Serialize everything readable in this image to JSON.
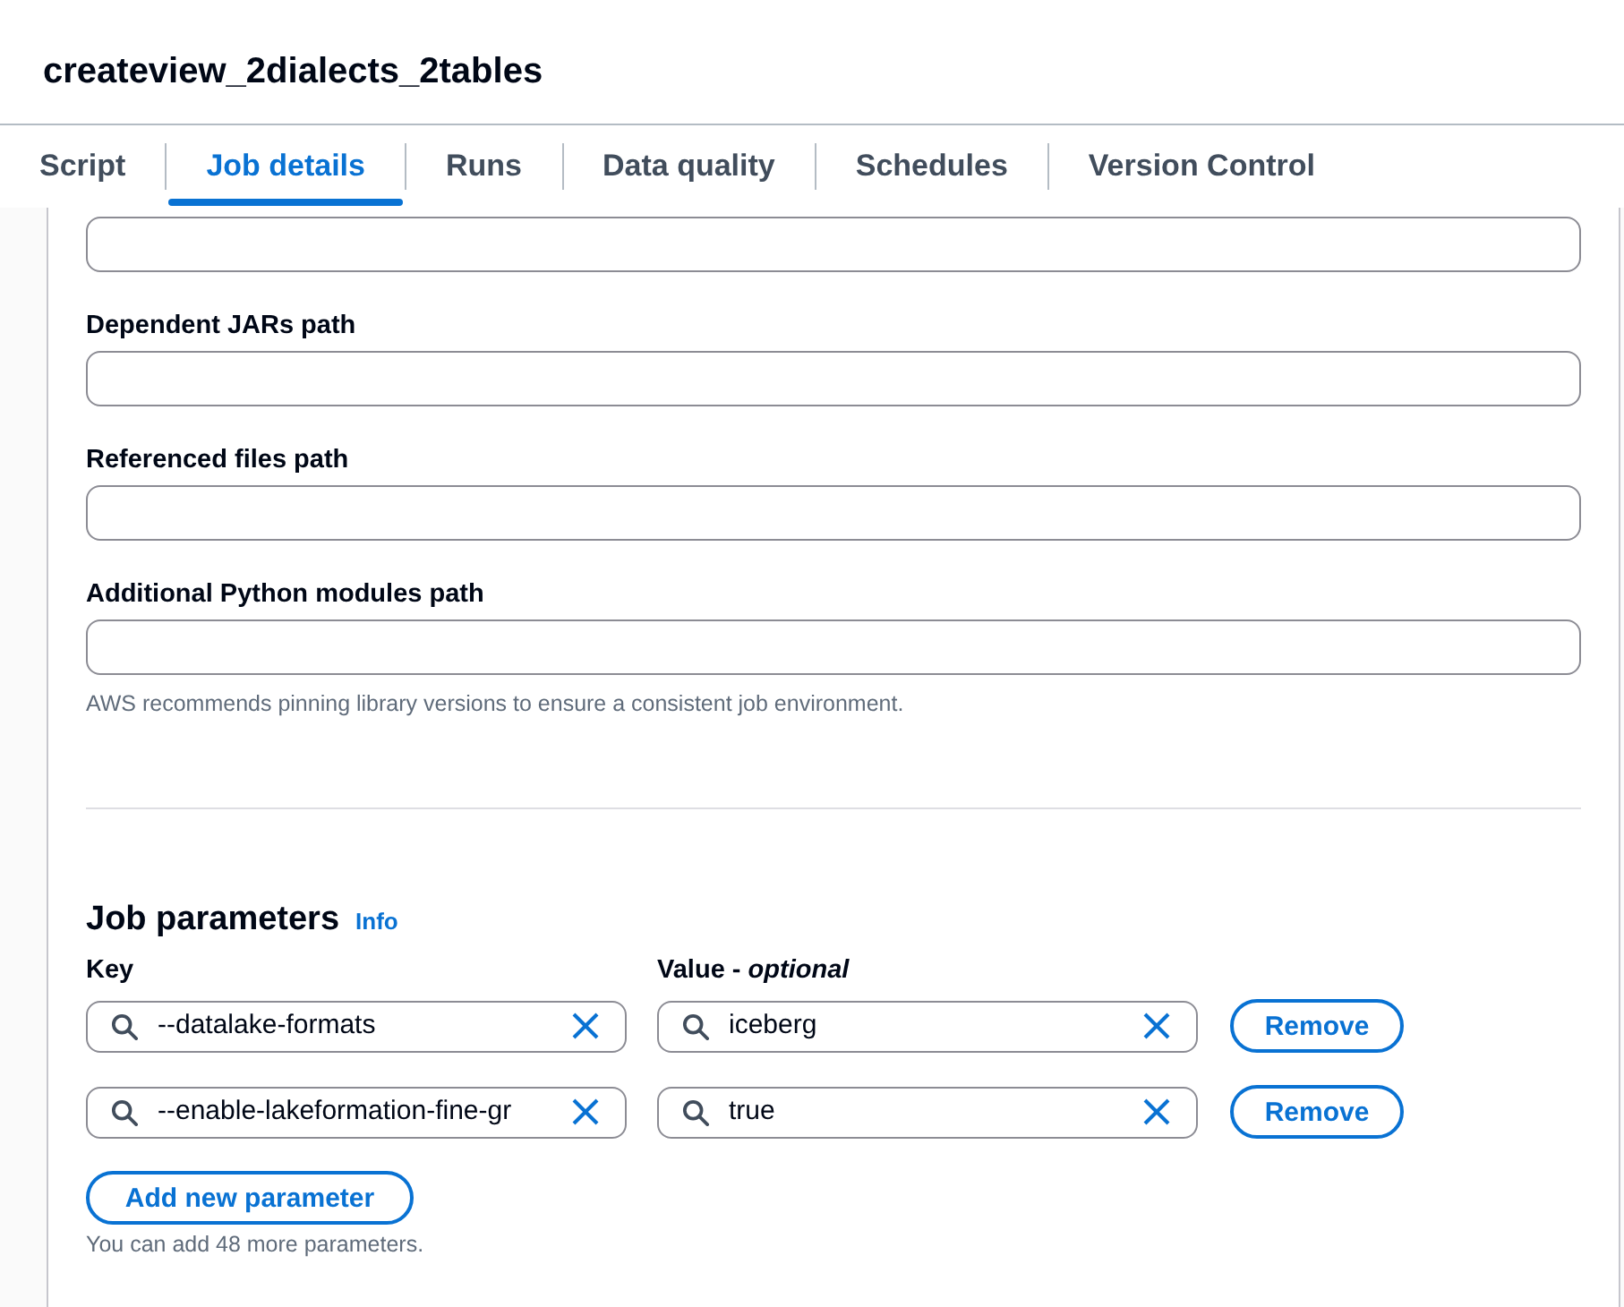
{
  "page_title": "createview_2dialects_2tables",
  "tabs": [
    {
      "label": "Script",
      "selected": false
    },
    {
      "label": "Job details",
      "selected": true
    },
    {
      "label": "Runs",
      "selected": false
    },
    {
      "label": "Data quality",
      "selected": false
    },
    {
      "label": "Schedules",
      "selected": false
    },
    {
      "label": "Version Control",
      "selected": false
    }
  ],
  "path_fields": [
    {
      "kind": "text_input"
    },
    {
      "kind": "text_input",
      "label": "Dependent JARs path"
    },
    {
      "kind": "text_input",
      "label": "Referenced files path"
    },
    {
      "kind": "text_input",
      "label": "Additional Python modules path"
    }
  ],
  "path_fields_help": "AWS recommends pinning library versions to ensure a consistent job environment.",
  "job_parameters": {
    "heading": "Job parameters",
    "info_link": "Info",
    "key_label": "Key",
    "value_label": "Value - *optional*",
    "rows": [
      {
        "key": "--datalake-formats",
        "value": "iceberg",
        "remove_button": "Remove"
      },
      {
        "key": "--enable-lakeformation-fine-gr",
        "value": "true",
        "remove_button": "Remove"
      }
    ],
    "add_button": "Add new parameter",
    "hint": "You can add 48 more parameters."
  }
}
